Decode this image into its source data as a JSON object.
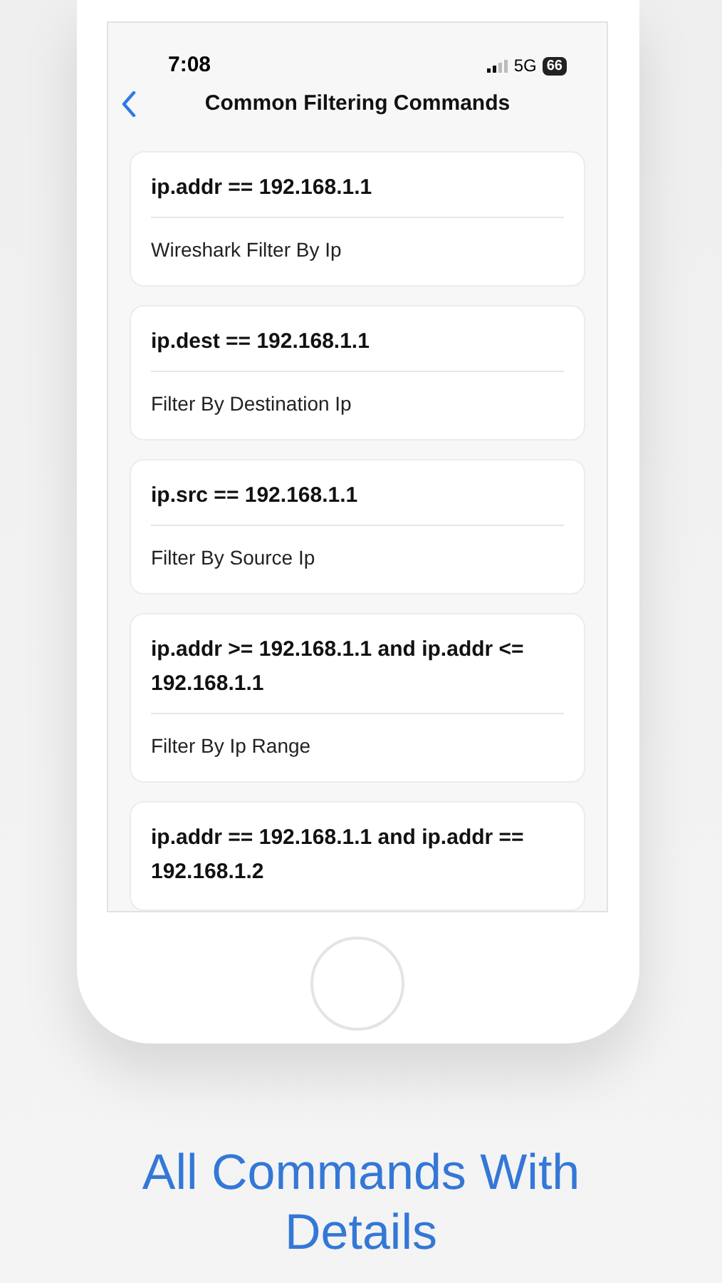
{
  "status_bar": {
    "time": "7:08",
    "network": "5G",
    "battery": "66"
  },
  "nav": {
    "title": "Common Filtering Commands"
  },
  "commands": [
    {
      "command": "ip.addr == 192.168.1.1",
      "description": "Wireshark Filter By Ip"
    },
    {
      "command": "ip.dest == 192.168.1.1",
      "description": "Filter By Destination Ip"
    },
    {
      "command": "ip.src == 192.168.1.1",
      "description": "Filter By Source Ip"
    },
    {
      "command": "ip.addr >= 192.168.1.1 and ip.addr <= 192.168.1.1",
      "description": "Filter By Ip Range"
    },
    {
      "command": "ip.addr == 192.168.1.1 and ip.addr == 192.168.1.2"
    }
  ],
  "caption": "All Commands With Details"
}
